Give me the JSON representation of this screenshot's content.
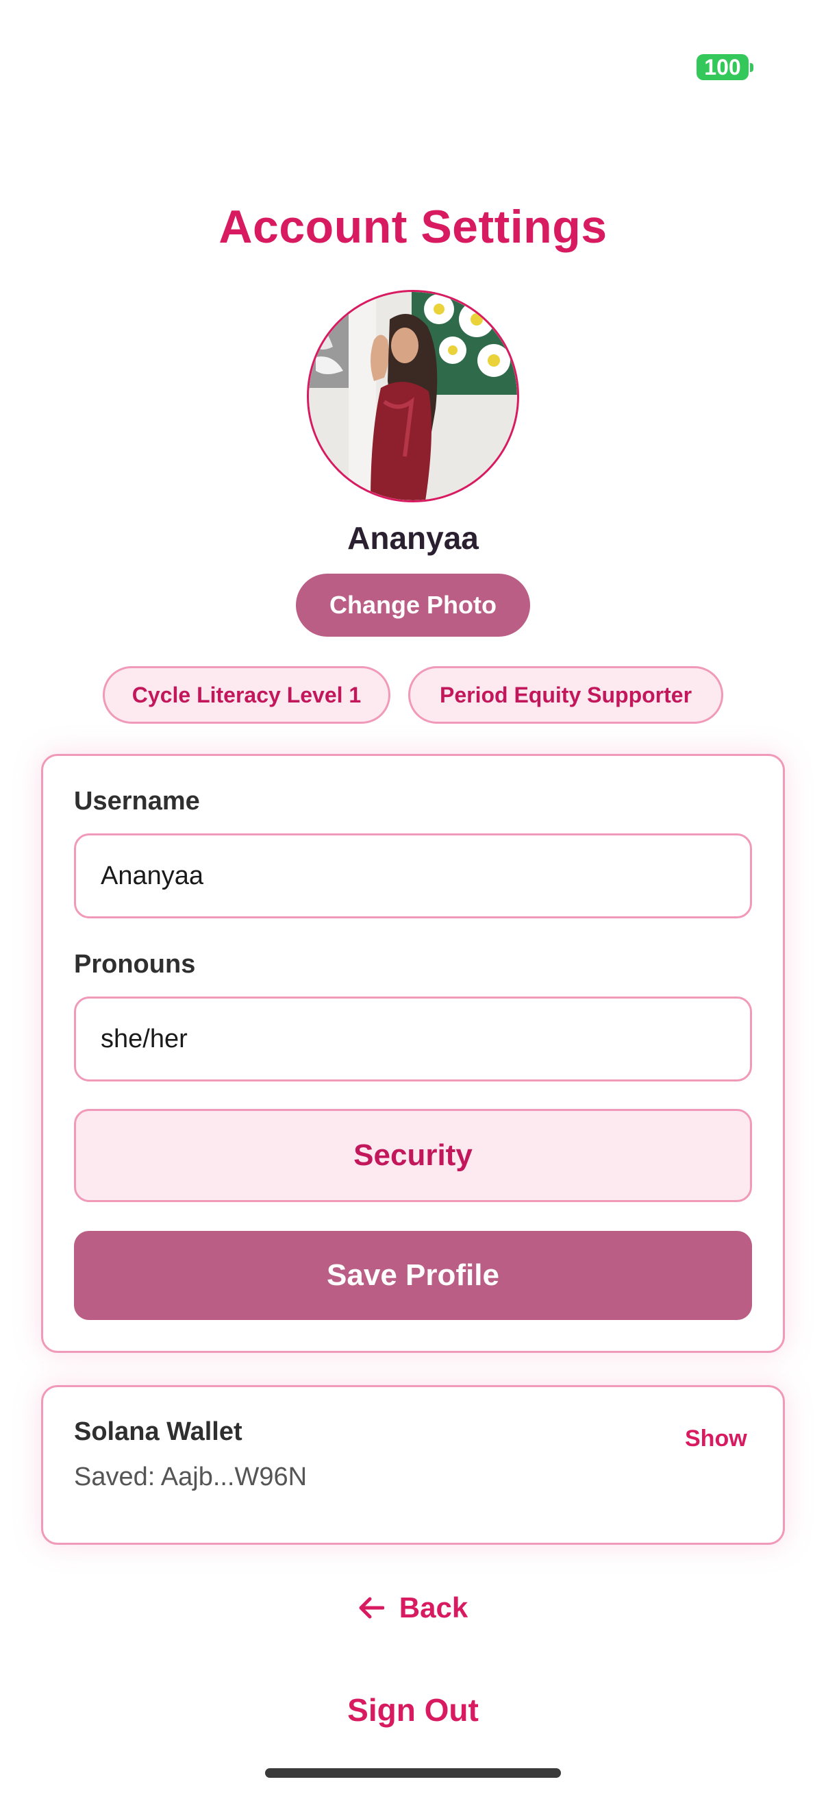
{
  "status_bar": {
    "battery": "100",
    "battery_icon": "battery-icon",
    "battery_color": "#34c759"
  },
  "header": {
    "title": "Account Settings"
  },
  "profile": {
    "avatar_icon": "profile-photo",
    "name": "Ananyaa",
    "change_photo_label": "Change Photo",
    "badges": [
      "Cycle Literacy Level 1",
      "Period Equity Supporter"
    ]
  },
  "form": {
    "username_label": "Username",
    "username_value": "Ananyaa",
    "pronouns_label": "Pronouns",
    "pronouns_value": "she/her",
    "security_label": "Security",
    "save_label": "Save Profile"
  },
  "wallet": {
    "title": "Solana Wallet",
    "saved_text": "Saved: Aajb...W96N",
    "show_label": "Show"
  },
  "footer": {
    "back_label": "Back",
    "back_icon": "arrow-left-icon",
    "sign_out_label": "Sign Out"
  },
  "colors": {
    "accent": "#d81b60",
    "button_fill": "#bb5e85",
    "border": "#f199b9",
    "soft_pink": "#fdeaf0"
  }
}
